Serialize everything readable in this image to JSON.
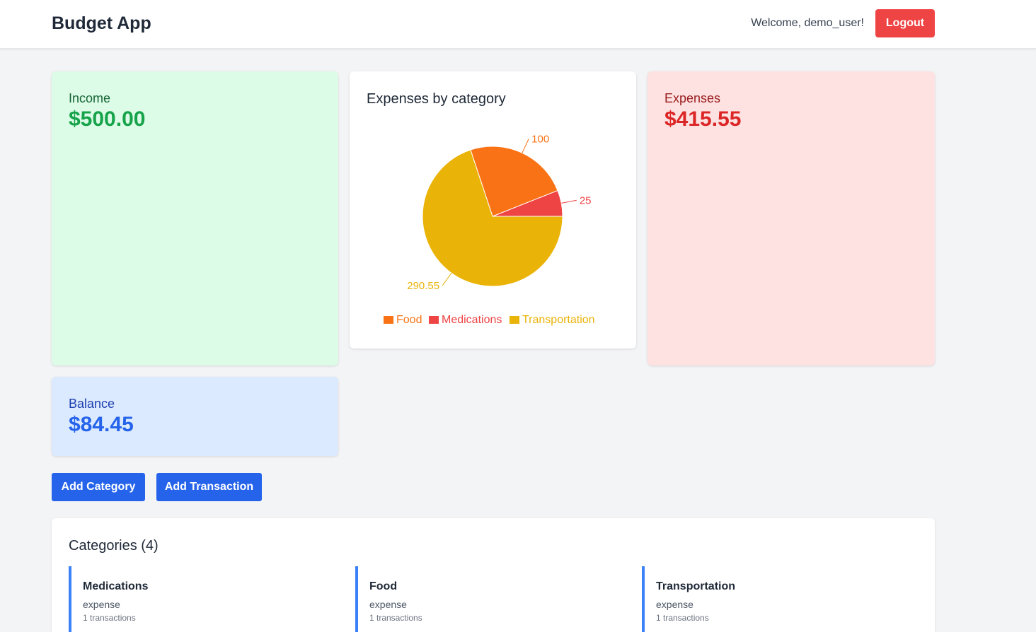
{
  "header": {
    "brand": "Budget App",
    "welcome": "Welcome, demo_user!",
    "logout_label": "Logout"
  },
  "summary": {
    "income_label": "Income",
    "income_amount": "$500.00",
    "expenses_label": "Expenses",
    "expenses_amount": "$415.55",
    "balance_label": "Balance",
    "balance_amount": "$84.45"
  },
  "chart_card": {
    "title": "Expenses by category"
  },
  "chart_data": {
    "type": "pie",
    "title": "Expenses by category",
    "categories": [
      "Food",
      "Medications",
      "Transportation"
    ],
    "values": [
      100,
      25,
      290.55
    ],
    "colors": [
      "#f97316",
      "#ef4444",
      "#eab308"
    ],
    "value_labels": [
      "100",
      "25",
      "290.55"
    ],
    "legend_position": "bottom"
  },
  "actions": {
    "add_category_label": "Add Category",
    "add_transaction_label": "Add Transaction"
  },
  "categories_panel": {
    "heading": "Categories (4)",
    "items": [
      {
        "name": "Medications",
        "type": "expense",
        "count": "1 transactions"
      },
      {
        "name": "Food",
        "type": "expense",
        "count": "1 transactions"
      },
      {
        "name": "Transportation",
        "type": "expense",
        "count": "1 transactions"
      }
    ]
  }
}
